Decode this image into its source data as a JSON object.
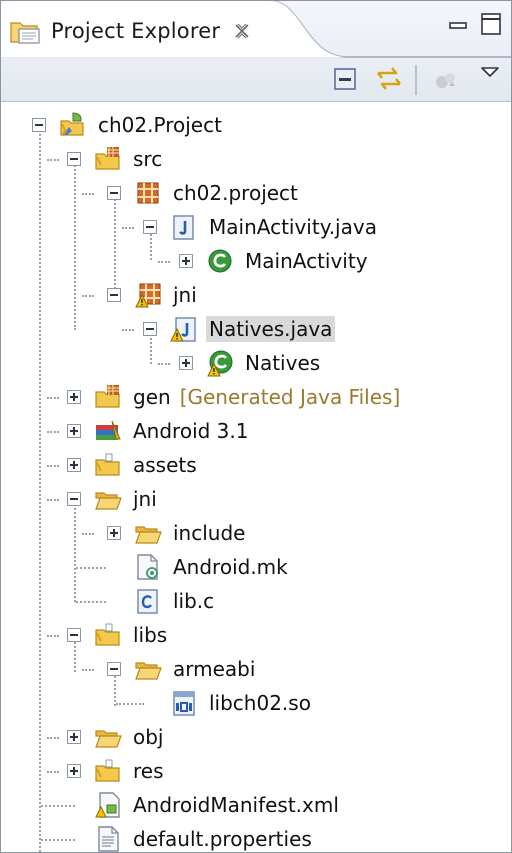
{
  "view": {
    "tab_title": "Project Explorer"
  },
  "tree": [
    {
      "label": "ch02.Project",
      "icon": "android-project-icon"
    },
    {
      "label": "src",
      "icon": "source-folder-icon"
    },
    {
      "label": "ch02.project",
      "icon": "package-icon"
    },
    {
      "label": "MainActivity.java",
      "icon": "java-file-icon"
    },
    {
      "label": "MainActivity",
      "icon": "class-icon"
    },
    {
      "label": "jni",
      "icon": "package-warning-icon"
    },
    {
      "label": "Natives.java",
      "icon": "java-file-warning-icon"
    },
    {
      "label": "Natives",
      "icon": "class-warning-icon"
    },
    {
      "label": "gen",
      "decoration": "[Generated Java Files]",
      "icon": "generated-folder-icon"
    },
    {
      "label": "Android 3.1",
      "icon": "library-icon"
    },
    {
      "label": "assets",
      "icon": "folder-icon"
    },
    {
      "label": "jni",
      "icon": "open-folder-icon"
    },
    {
      "label": "include",
      "icon": "open-folder-icon"
    },
    {
      "label": "Android.mk",
      "icon": "makefile-icon"
    },
    {
      "label": "lib.c",
      "icon": "c-file-icon"
    },
    {
      "label": "libs",
      "icon": "folder-icon"
    },
    {
      "label": "armeabi",
      "icon": "open-folder-icon"
    },
    {
      "label": "libch02.so",
      "icon": "binary-file-icon"
    },
    {
      "label": "obj",
      "icon": "open-folder-icon"
    },
    {
      "label": "res",
      "icon": "folder-icon"
    },
    {
      "label": "AndroidManifest.xml",
      "icon": "manifest-file-icon"
    },
    {
      "label": "default.properties",
      "icon": "properties-file-icon"
    }
  ],
  "colors": {
    "selection": "#d9d9d9",
    "decoration": "#9b7a2c",
    "folder": "#f2c94c",
    "java_blue": "#2a5db0",
    "class_green": "#3a9a3a"
  }
}
